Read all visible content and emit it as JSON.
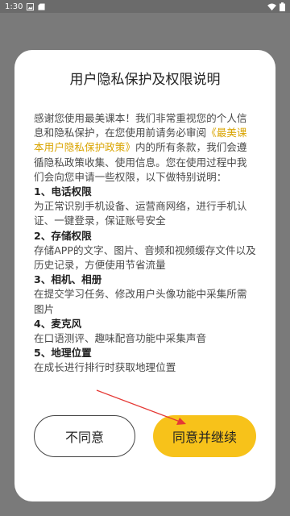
{
  "status_bar": {
    "time": "1:30"
  },
  "dialog": {
    "title": "用户隐私保护及权限说明",
    "intro_1": "感谢您使用最美课本！我们非常重视您的个人信息和隐私保护，在您使用前请务必审阅",
    "policy_link": "《最美课本用户隐私保护政策》",
    "intro_2": "内的所有条款，我们会遵循隐私政策收集、使用信息。您在使用过程中我们会向您申请一些权限，以下做特别说明：",
    "sections": [
      {
        "title": "1、电话权限",
        "text": "为正常识别手机设备、运营商网络，进行手机认证、一键登录，保证账号安全"
      },
      {
        "title": "2、存储权限",
        "text": "存储APP的文字、图片、音频和视频缓存文件以及历史记录，方便使用节省流量"
      },
      {
        "title": "3、相机、相册",
        "text": "在提交学习任务、修改用户头像功能中采集所需图片"
      },
      {
        "title": "4、麦克风",
        "text": "在口语测评、趣味配音功能中采集声音"
      },
      {
        "title": "5、地理位置",
        "text": "在成长进行排行时获取地理位置"
      }
    ],
    "disagree_label": "不同意",
    "agree_label": "同意并继续"
  },
  "colors": {
    "accent": "#f7c21a",
    "link": "#d9a400",
    "arrow": "#e53935"
  },
  "icons": [
    "image-icon",
    "sd-card-icon",
    "wifi-icon",
    "battery-icon"
  ]
}
